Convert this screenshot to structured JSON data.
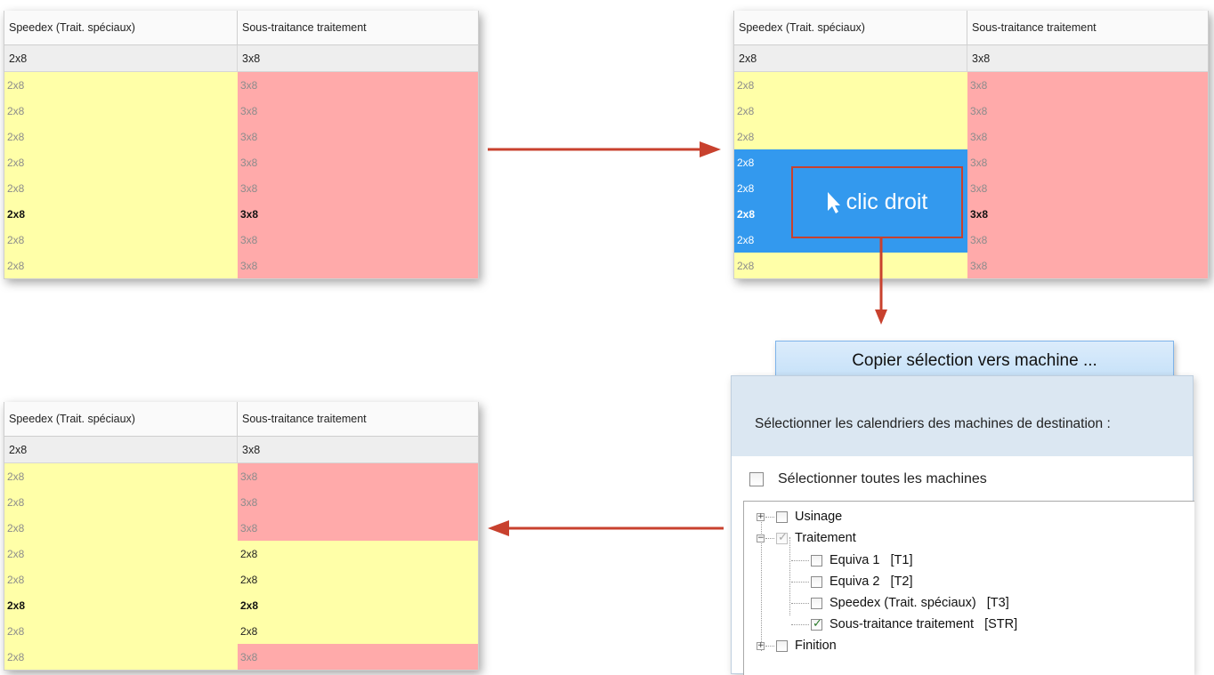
{
  "grid": {
    "col1_header": "Speedex (Trait. spéciaux)",
    "col2_header": "Sous-traitance traitement"
  },
  "grid_before": {
    "total": [
      "2x8",
      "3x8"
    ],
    "rows": [
      [
        "2x8",
        "3x8"
      ],
      [
        "2x8",
        "3x8"
      ],
      [
        "2x8",
        "3x8"
      ],
      [
        "2x8",
        "3x8"
      ],
      [
        "2x8",
        "3x8"
      ],
      [
        "2x8",
        "3x8"
      ],
      [
        "2x8",
        "3x8"
      ],
      [
        "2x8",
        "3x8"
      ]
    ]
  },
  "grid_selected": {
    "total": [
      "2x8",
      "3x8"
    ],
    "rows": [
      [
        "2x8",
        "3x8"
      ],
      [
        "2x8",
        "3x8"
      ],
      [
        "2x8",
        "3x8"
      ],
      [
        "2x8",
        "3x8"
      ],
      [
        "2x8",
        "3x8"
      ],
      [
        "2x8",
        "3x8"
      ],
      [
        "2x8",
        "3x8"
      ],
      [
        "2x8",
        "3x8"
      ]
    ]
  },
  "grid_after": {
    "total": [
      "2x8",
      "3x8"
    ],
    "rows": [
      [
        "2x8",
        "3x8"
      ],
      [
        "2x8",
        "3x8"
      ],
      [
        "2x8",
        "3x8"
      ],
      [
        "2x8",
        "2x8"
      ],
      [
        "2x8",
        "2x8"
      ],
      [
        "2x8",
        "2x8"
      ],
      [
        "2x8",
        "2x8"
      ],
      [
        "2x8",
        "3x8"
      ]
    ]
  },
  "callout": {
    "text": "clic droit",
    "icon": "cursor-arrow-icon"
  },
  "context_menu": {
    "item": "Copier sélection vers machine ..."
  },
  "dialog": {
    "title": "Sélectionner les calendriers des machines de destination :",
    "select_all": "Sélectionner toutes les machines",
    "tree": {
      "usinage": "Usinage",
      "traitement": "Traitement",
      "equiva1": "Equiva 1   [T1]",
      "equiva2": "Equiva 2   [T2]",
      "speedex": "Speedex (Trait. spéciaux)   [T3]",
      "soustraitance": "Sous-traitance traitement   [STR]",
      "finition": "Finition"
    }
  },
  "colors": {
    "yellow_cell": "#ffffa8",
    "red_cell": "#ffaaaa",
    "selection": "#3399ee",
    "arrow": "#c8412e"
  }
}
